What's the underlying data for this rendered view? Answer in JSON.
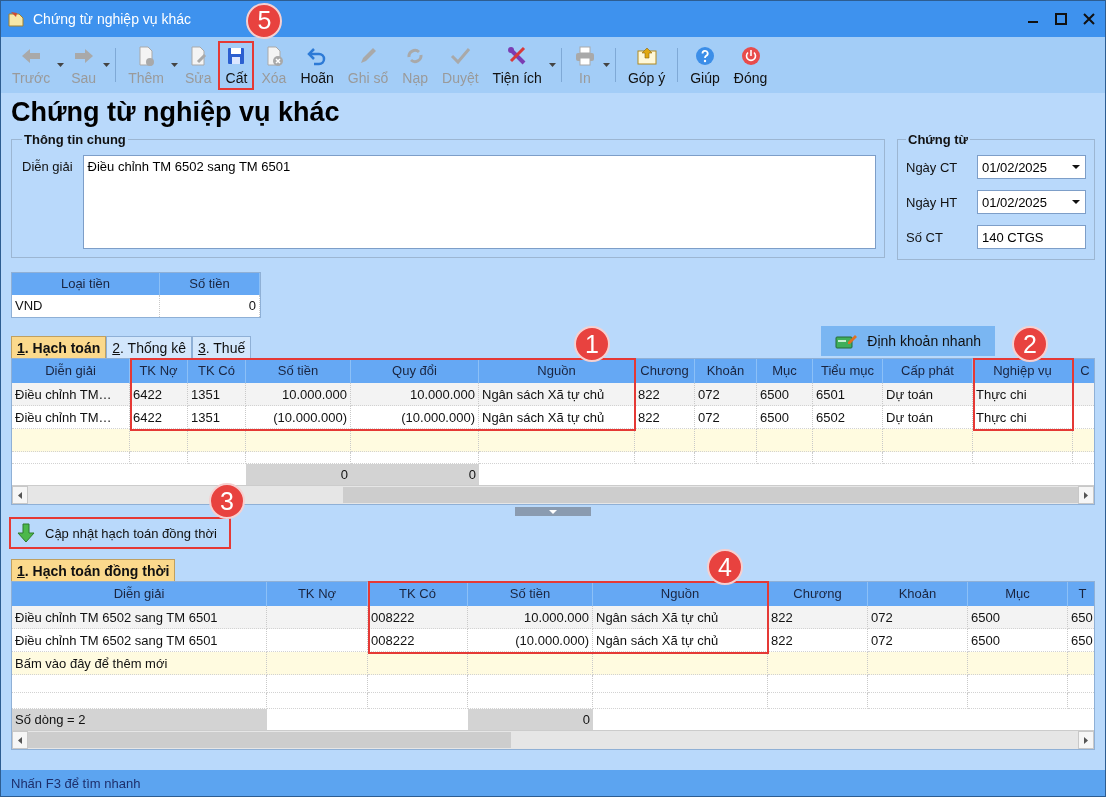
{
  "window": {
    "title": "Chứng từ nghiệp vụ khác"
  },
  "toolbar": [
    {
      "label": "Trước",
      "enabled": false,
      "dropdown": true,
      "separator_after": false,
      "highlighted": false
    },
    {
      "label": "Sau",
      "enabled": false,
      "dropdown": true,
      "separator_after": true,
      "highlighted": false
    },
    {
      "label": "Thêm",
      "enabled": false,
      "dropdown": true,
      "separator_after": false,
      "highlighted": false
    },
    {
      "label": "Sửa",
      "enabled": false,
      "dropdown": false,
      "separator_after": false,
      "highlighted": false
    },
    {
      "label": "Cất",
      "enabled": true,
      "dropdown": false,
      "separator_after": false,
      "highlighted": true,
      "badge": "5"
    },
    {
      "label": "Xóa",
      "enabled": false,
      "dropdown": false,
      "separator_after": false,
      "highlighted": false
    },
    {
      "label": "Hoãn",
      "enabled": true,
      "dropdown": false,
      "separator_after": false,
      "highlighted": false
    },
    {
      "label": "Ghi sổ",
      "enabled": false,
      "dropdown": false,
      "separator_after": false,
      "highlighted": false
    },
    {
      "label": "Nạp",
      "enabled": false,
      "dropdown": false,
      "separator_after": false,
      "highlighted": false
    },
    {
      "label": "Duyệt",
      "enabled": false,
      "dropdown": false,
      "separator_after": false,
      "highlighted": false
    },
    {
      "label": "Tiện ích",
      "enabled": true,
      "dropdown": true,
      "separator_after": true,
      "highlighted": false
    },
    {
      "label": "In",
      "enabled": false,
      "dropdown": true,
      "separator_after": true,
      "highlighted": false
    },
    {
      "label": "Góp ý",
      "enabled": true,
      "dropdown": false,
      "separator_after": true,
      "highlighted": false
    },
    {
      "label": "Giúp",
      "enabled": true,
      "dropdown": false,
      "separator_after": false,
      "highlighted": false
    },
    {
      "label": "Đóng",
      "enabled": true,
      "dropdown": false,
      "separator_after": false,
      "highlighted": false
    }
  ],
  "heading": "Chứng từ nghiệp vụ khác",
  "general_info": {
    "title": "Thông tin chung",
    "label": "Diễn giải",
    "value": "Điều chỉnh TM 6502 sang TM 6501"
  },
  "voucher": {
    "title": "Chứng từ",
    "fields": [
      {
        "label": "Ngày CT",
        "value": "01/02/2025",
        "kind": "date"
      },
      {
        "label": "Ngày HT",
        "value": "01/02/2025",
        "kind": "date"
      },
      {
        "label": "Số CT",
        "value": "140 CTGS",
        "kind": "text"
      }
    ]
  },
  "currency": {
    "columns": [
      "Loại tiền",
      "Số tiền"
    ],
    "row": [
      "VND",
      "0"
    ]
  },
  "entries": {
    "tabs": [
      {
        "label": "1. Hạch toán",
        "selected": true
      },
      {
        "label": "2. Thống kê",
        "selected": false
      },
      {
        "label": "3. Thuế",
        "selected": false
      }
    ],
    "quick_button": {
      "label": "Định khoản nhanh"
    },
    "columns": [
      {
        "title": "Diễn giải",
        "kind": "text",
        "highlighted": false
      },
      {
        "title": "TK Nợ",
        "kind": "text",
        "highlighted": true
      },
      {
        "title": "TK Có",
        "kind": "text",
        "highlighted": true
      },
      {
        "title": "Số tiền",
        "kind": "amount",
        "highlighted": true,
        "total": "0"
      },
      {
        "title": "Quy đổi",
        "kind": "amount",
        "highlighted": true,
        "total": "0"
      },
      {
        "title": "Nguồn",
        "kind": "text",
        "highlighted": true,
        "badge": "1"
      },
      {
        "title": "Chương",
        "kind": "text",
        "highlighted": false
      },
      {
        "title": "Khoản",
        "kind": "text",
        "highlighted": false
      },
      {
        "title": "Mục",
        "kind": "text",
        "highlighted": false
      },
      {
        "title": "Tiểu mục",
        "kind": "text",
        "highlighted": false
      },
      {
        "title": "Cấp phát",
        "kind": "text",
        "highlighted": false
      },
      {
        "title": "Nghiệp vụ",
        "kind": "text",
        "highlighted": true,
        "badge": "2"
      },
      {
        "title": "C",
        "kind": "text",
        "highlighted": false
      }
    ],
    "rows": [
      [
        "Điều chỉnh TM…",
        "6422",
        "1351",
        "10.000.000",
        "10.000.000",
        "Ngân sách Xã tự chủ",
        "822",
        "072",
        "6500",
        "6501",
        "Dự toán",
        "Thực chi",
        ""
      ],
      [
        "Điều chỉnh TM…",
        "6422",
        "1351",
        "(10.000.000)",
        "(10.000.000)",
        "Ngân sách Xã tự chủ",
        "822",
        "072",
        "6500",
        "6502",
        "Dự toán",
        "Thực chi",
        ""
      ]
    ]
  },
  "update_button": {
    "label": "Cập nhật hạch toán đồng thời",
    "highlighted": true,
    "badge": "3"
  },
  "concurrent_entries": {
    "tabs": [
      {
        "label": "1. Hạch toán đồng thời",
        "selected": true
      }
    ],
    "columns": [
      {
        "title": "Diễn giải",
        "kind": "text",
        "highlighted": false,
        "total": "Số dòng = 2"
      },
      {
        "title": "TK Nợ",
        "kind": "text",
        "highlighted": false
      },
      {
        "title": "TK Có",
        "kind": "text",
        "highlighted": true
      },
      {
        "title": "Số tiền",
        "kind": "amount",
        "highlighted": true,
        "total": "0"
      },
      {
        "title": "Nguồn",
        "kind": "text",
        "highlighted": true,
        "badge": "4"
      },
      {
        "title": "Chương",
        "kind": "text",
        "highlighted": false
      },
      {
        "title": "Khoản",
        "kind": "text",
        "highlighted": false
      },
      {
        "title": "Mục",
        "kind": "text",
        "highlighted": false
      },
      {
        "title": "T",
        "kind": "text",
        "highlighted": false
      }
    ],
    "rows": [
      [
        "Điều chỉnh TM 6502 sang TM 6501",
        "",
        "008222",
        "10.000.000",
        "Ngân sách Xã tự chủ",
        "822",
        "072",
        "6500",
        "650"
      ],
      [
        "Điều chỉnh TM 6502 sang TM 6501",
        "",
        "008222",
        "(10.000.000)",
        "Ngân sách Xã tự chủ",
        "822",
        "072",
        "6500",
        "650"
      ]
    ],
    "new_row": {
      "placeholder": "Bấm vào đây để thêm mới"
    }
  },
  "status_bar": "Nhấn F3 để tìm nhanh"
}
